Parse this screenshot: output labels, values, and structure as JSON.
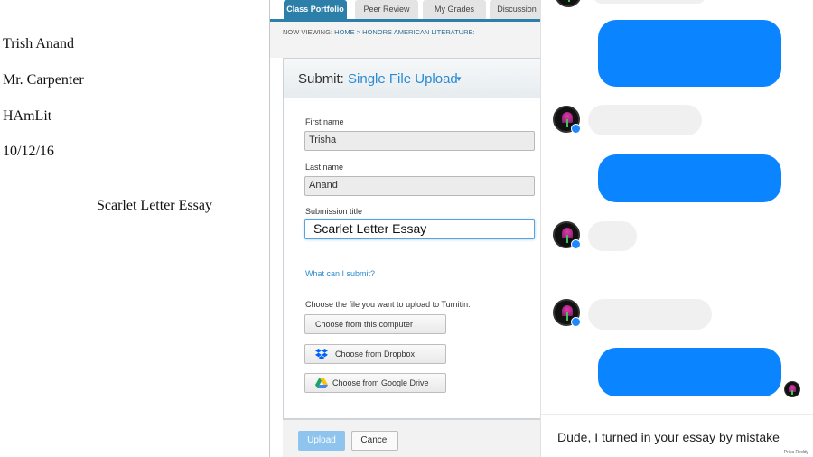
{
  "essay": {
    "student_name": "Trish Anand",
    "teacher": "Mr. Carpenter",
    "course": "HAmLit",
    "date": "10/12/16",
    "title": "Scarlet Letter Essay"
  },
  "turnitin": {
    "tabs": [
      {
        "label": "Class Portfolio",
        "active": true
      },
      {
        "label": "Peer Review",
        "active": false
      },
      {
        "label": "My Grades",
        "active": false
      },
      {
        "label": "Discussion",
        "active": false
      }
    ],
    "now_viewing_label": "NOW VIEWING:",
    "breadcrumb": "HOME > HONORS AMERICAN LITERATURE:",
    "submit_label": "Submit:",
    "submit_type": "Single File Upload",
    "first_name_label": "First name",
    "first_name_value": "Trisha",
    "last_name_label": "Last name",
    "last_name_value": "Anand",
    "submission_title_label": "Submission title",
    "submission_title_value": "Scarlet Letter Essay",
    "help_link": "What can I submit?",
    "choose_file_label": "Choose the file you want to upload to Turnitin:",
    "choose_computer": "Choose from this computer",
    "choose_dropbox": "Choose from Dropbox",
    "choose_drive": "Choose from Google Drive",
    "upload_button": "Upload",
    "cancel_button": "Cancel"
  },
  "messenger": {
    "caption": "Dude, I turned in your essay by mistake",
    "watermark": "Priya Reddy",
    "colors": {
      "outgoing": "#0a84ff",
      "incoming": "#f1f0f0"
    }
  }
}
